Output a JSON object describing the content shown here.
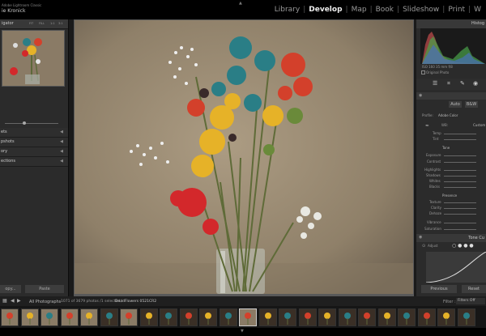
{
  "header": {
    "brand_line1": "Adobe Lightroom Classic",
    "brand_line2": "ie Kronick",
    "modules": [
      "Library",
      "Develop",
      "Map",
      "Book",
      "Slideshow",
      "Print",
      "W"
    ],
    "active_module": "Develop"
  },
  "left_panel": {
    "navigator_title": "igator",
    "zoom_opts": [
      "FIT",
      "FILL",
      "1:1",
      "3:1"
    ],
    "zoom_value": "",
    "sections": [
      "ets",
      "pshots",
      "ory",
      "ections"
    ],
    "copy_label": "opy...",
    "paste_label": "Paste"
  },
  "right_panel": {
    "histogram_title": "Histog",
    "original_photo_label": "Original Photo",
    "auto_label": "Auto",
    "bw_label": "B&W",
    "profile_label": "Profile:",
    "profile_value": "Adobe Color",
    "wb_label": "WB:",
    "wb_value": "Custom",
    "temp_label": "Temp",
    "tint_label": "Tint",
    "tone_label": "Tone",
    "exposure_label": "Exposure",
    "contrast_label": "Contrast",
    "highlights_label": "Highlights",
    "shadows_label": "Shadows",
    "whites_label": "Whites",
    "blacks_label": "Blacks",
    "presence_label": "Presence",
    "texture_label": "Texture",
    "clarity_label": "Clarity",
    "dehaze_label": "Dehaze",
    "vibrance_label": "Vibrance",
    "saturation_label": "Saturation",
    "tone_curve_title": "Tone Cu",
    "adjust_label": "Adjust",
    "previous_label": "Previous",
    "reset_label": "Reset"
  },
  "bottom": {
    "source_label": "All Photographs",
    "count_label": "1071 of 3679 photos /1 selected /",
    "filename": "DeadFlowers 0521CR2",
    "filter_label": "Filter :",
    "filter_value": "Filters Off"
  },
  "colors": {
    "background": "#0d0d0d",
    "panel": "#2b2b2b",
    "wall": "#9b8b74",
    "flower_red": "#d3282b",
    "flower_yellow": "#e6b228",
    "flower_teal": "#2a7e86"
  }
}
